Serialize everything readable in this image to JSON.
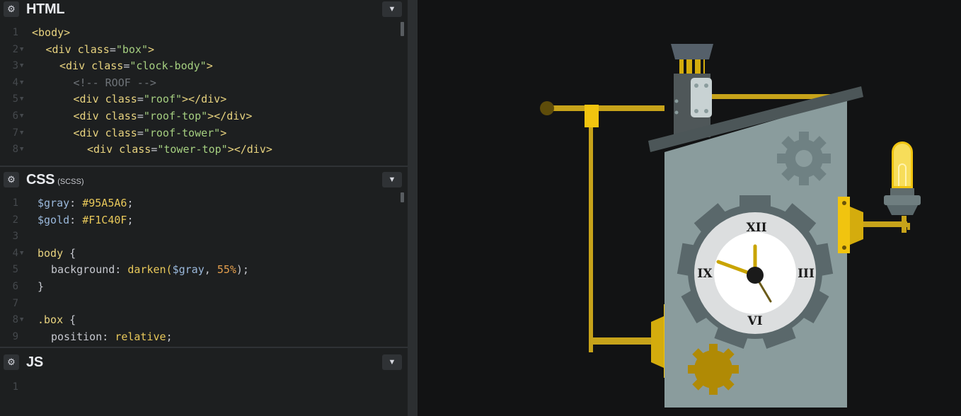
{
  "panels": {
    "html": {
      "title": "HTML",
      "lines": [
        {
          "n": "1",
          "indent": 0,
          "tokens": [
            [
              "tag",
              "<body>"
            ]
          ]
        },
        {
          "n": "2",
          "indent": 1,
          "tokens": [
            [
              "tag",
              "<div "
            ],
            [
              "attr",
              "class"
            ],
            [
              "plain",
              "="
            ],
            [
              "str",
              "\"box\""
            ],
            [
              "tag",
              ">"
            ]
          ]
        },
        {
          "n": "3",
          "indent": 2,
          "tokens": [
            [
              "tag",
              "<div "
            ],
            [
              "attr",
              "class"
            ],
            [
              "plain",
              "="
            ],
            [
              "str",
              "\"clock-body\""
            ],
            [
              "tag",
              ">"
            ]
          ]
        },
        {
          "n": "4",
          "indent": 3,
          "tokens": [
            [
              "cmt",
              "<!-- ROOF -->"
            ]
          ]
        },
        {
          "n": "5",
          "indent": 3,
          "tokens": [
            [
              "tag",
              "<div "
            ],
            [
              "attr",
              "class"
            ],
            [
              "plain",
              "="
            ],
            [
              "str",
              "\"roof\""
            ],
            [
              "tag",
              "></div>"
            ]
          ]
        },
        {
          "n": "6",
          "indent": 3,
          "tokens": [
            [
              "tag",
              "<div "
            ],
            [
              "attr",
              "class"
            ],
            [
              "plain",
              "="
            ],
            [
              "str",
              "\"roof-top\""
            ],
            [
              "tag",
              "></div>"
            ]
          ]
        },
        {
          "n": "7",
          "indent": 3,
          "tokens": [
            [
              "tag",
              "<div "
            ],
            [
              "attr",
              "class"
            ],
            [
              "plain",
              "="
            ],
            [
              "str",
              "\"roof-tower\""
            ],
            [
              "tag",
              ">"
            ]
          ]
        },
        {
          "n": "8",
          "indent": 4,
          "tokens": [
            [
              "tag",
              "<div "
            ],
            [
              "attr",
              "class"
            ],
            [
              "plain",
              "="
            ],
            [
              "str",
              "\"tower-top\""
            ],
            [
              "tag",
              "></div>"
            ]
          ]
        }
      ]
    },
    "css": {
      "title": "CSS",
      "subtitle": "(SCSS)",
      "lines": [
        {
          "n": "1",
          "indent": 0,
          "tokens": [
            [
              "var",
              "$gray"
            ],
            [
              "plain",
              ": "
            ],
            [
              "val",
              "#95A5A6"
            ],
            [
              "plain",
              ";"
            ]
          ]
        },
        {
          "n": "2",
          "indent": 0,
          "tokens": [
            [
              "var",
              "$gold"
            ],
            [
              "plain",
              ": "
            ],
            [
              "val",
              "#F1C40F"
            ],
            [
              "plain",
              ";"
            ]
          ]
        },
        {
          "n": "3",
          "indent": 0,
          "tokens": []
        },
        {
          "n": "4",
          "indent": 0,
          "tokens": [
            [
              "sel",
              "body"
            ],
            [
              "plain",
              " {"
            ]
          ]
        },
        {
          "n": "5",
          "indent": 1,
          "tokens": [
            [
              "plain",
              "background: "
            ],
            [
              "val",
              "darken("
            ],
            [
              "var",
              "$gray"
            ],
            [
              "plain",
              ", "
            ],
            [
              "num",
              "55%"
            ],
            [
              "plain",
              ");"
            ]
          ]
        },
        {
          "n": "6",
          "indent": 0,
          "tokens": [
            [
              "plain",
              "}"
            ]
          ]
        },
        {
          "n": "7",
          "indent": 0,
          "tokens": []
        },
        {
          "n": "8",
          "indent": 0,
          "tokens": [
            [
              "sel",
              ".box"
            ],
            [
              "plain",
              " {"
            ]
          ]
        },
        {
          "n": "9",
          "indent": 1,
          "tokens": [
            [
              "plain",
              "position: "
            ],
            [
              "val",
              "relative"
            ],
            [
              "plain",
              ";"
            ]
          ]
        }
      ]
    },
    "js": {
      "title": "JS",
      "lines": [
        {
          "n": "1",
          "indent": 0,
          "tokens": []
        }
      ]
    }
  },
  "icons": {
    "settings": "gear-icon",
    "collapse": "chevron-down-icon"
  },
  "preview": {
    "clock": {
      "numerals": {
        "top": "XII",
        "left": "IX",
        "right": "III",
        "bottom": "VI"
      }
    }
  },
  "colors": {
    "gray": "#95A5A6",
    "gold": "#F1C40F",
    "background": "#121314",
    "editor_bg": "#1d1f20"
  }
}
